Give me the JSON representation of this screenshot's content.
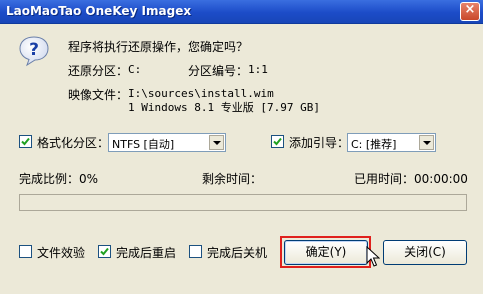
{
  "window": {
    "title": "LaoMaoTao OneKey Imagex",
    "close_symbol": "×"
  },
  "icons": {
    "dialog": "question-icon",
    "cursor": "arrow-cursor"
  },
  "message": {
    "question": "程序将执行还原操作，您确定吗？",
    "restore_partition_label": "还原分区：",
    "restore_partition_value": "C:",
    "partition_number_label": "分区编号：",
    "partition_number_value": "1:1",
    "image_file_label": "映像文件：",
    "image_file_path": "I:\\sources\\install.wim",
    "image_file_desc": "1 Windows 8.1 专业版 [7.97 GB]"
  },
  "options": {
    "format_label": "格式化分区：",
    "format_checked": true,
    "format_select_value": "NTFS [自动]",
    "boot_label": "添加引导：",
    "boot_checked": true,
    "boot_select_value": "C: [推荐]"
  },
  "progress": {
    "ratio_text": "完成比例：0%",
    "remaining_label": "剩余时间：",
    "elapsed_text": "已用时间：00:00:00",
    "value": 0
  },
  "bottom": {
    "verify_label": "文件效验",
    "verify_checked": false,
    "reboot_label": "完成后重启",
    "reboot_checked": true,
    "shutdown_label": "完成后关机",
    "shutdown_checked": false,
    "ok_label": "确定(Y)",
    "close_label": "关闭(C)"
  },
  "colors": {
    "titlebar": "#1c4cc8",
    "highlight": "#e0201c",
    "progress": "#3c9b3c"
  }
}
